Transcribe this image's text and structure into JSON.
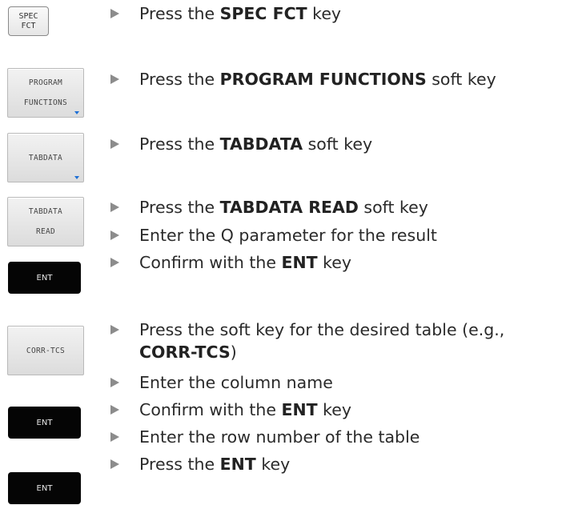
{
  "keys": {
    "spec_fct": "SPEC\nFCT",
    "program_functions": "PROGRAM\nFUNCTIONS",
    "tabdata": "TABDATA",
    "tabdata_read": "TABDATA\nREAD",
    "ent_1": "ENT",
    "corr_tcs": "CORR-TCS",
    "ent_2": "ENT",
    "ent_3": "ENT"
  },
  "steps": [
    {
      "pre": "Press the ",
      "bold": "SPEC FCT",
      "post": " key"
    },
    {
      "pre": "Press the ",
      "bold": "PROGRAM FUNCTIONS",
      "post": " soft key"
    },
    {
      "pre": "Press the ",
      "bold": "TABDATA",
      "post": " soft key"
    },
    {
      "pre": "Press the ",
      "bold": "TABDATA READ",
      "post": " soft key"
    },
    {
      "text": "Enter the Q parameter for the result"
    },
    {
      "pre": "Confirm with the ",
      "bold": "ENT",
      "post": " key"
    },
    {
      "pre": "Press the soft key for the desired table (e.g.,",
      "bold": "CORR-TCS",
      "post": ")"
    },
    {
      "text": "Enter the column name"
    },
    {
      "pre": "Confirm with the ",
      "bold": "ENT",
      "post": " key"
    },
    {
      "text": "Enter the row number of the table"
    },
    {
      "pre": "Press the ",
      "bold": "ENT",
      "post": " key"
    }
  ],
  "icons": {
    "bullet": "triangle-right-icon",
    "softkey_more": "blue-down-arrow-icon"
  }
}
